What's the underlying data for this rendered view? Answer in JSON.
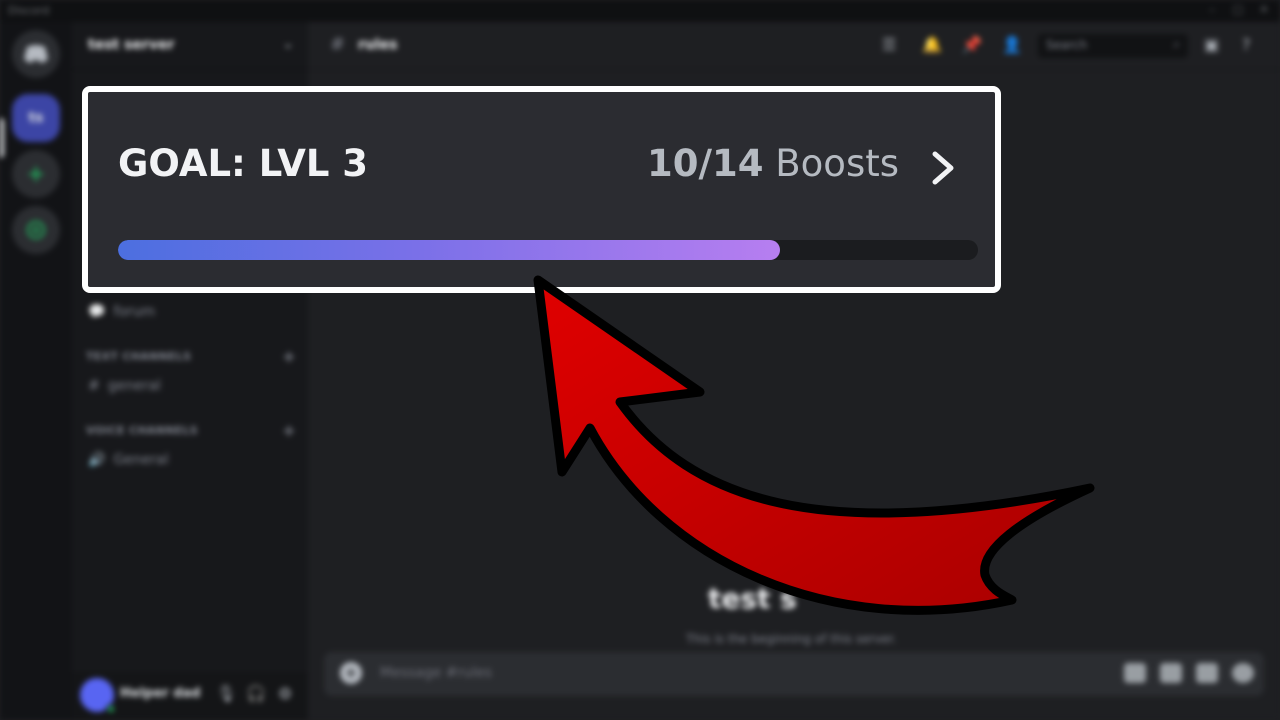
{
  "titlebar": {
    "app_title": "Discord"
  },
  "server_rail": {
    "servers": [
      {
        "label": ""
      },
      {
        "label": "ts"
      },
      {
        "label": "+"
      },
      {
        "label": ""
      }
    ]
  },
  "sidebar": {
    "server_name": "test server",
    "forum_label": "forum",
    "text_category": "TEXT CHANNELS",
    "text_channel": "general",
    "voice_category": "VOICE CHANNELS",
    "voice_channel": "General"
  },
  "user_panel": {
    "username": "Helper dad"
  },
  "main": {
    "channel_name": "rules",
    "search_placeholder": "Search",
    "welcome_title": "test s",
    "welcome_subtitle": "This is the beginning of this server.",
    "composer_placeholder": "Message #rules"
  },
  "boost_goal": {
    "goal_label": "GOAL: LVL 3",
    "current": "10/14",
    "unit": "Boosts",
    "progress_fraction": 0.77
  },
  "colors": {
    "panel_bg": "#2b2c31",
    "progress_start": "#4c6fe0",
    "progress_end": "#b77ef0",
    "arrow_red": "#d40000"
  }
}
